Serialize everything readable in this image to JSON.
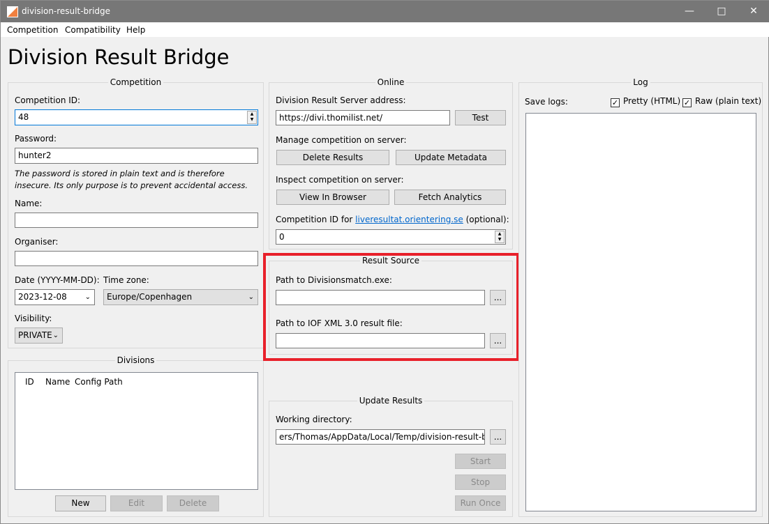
{
  "window": {
    "title": "division-result-bridge",
    "controls": [
      "minimize",
      "maximize",
      "close"
    ]
  },
  "menu": [
    "Competition",
    "Compatibility",
    "Help"
  ],
  "heading": "Division Result Bridge",
  "competition": {
    "title": "Competition",
    "id_label": "Competition ID:",
    "id_value": "48",
    "password_label": "Password:",
    "password_value": "hunter2",
    "password_note": "The password is stored in plain text and is therefore insecure. Its only purpose is to prevent accidental access.",
    "name_label": "Name:",
    "name_value": "",
    "organiser_label": "Organiser:",
    "organiser_value": "",
    "date_label": "Date (YYYY-MM-DD):",
    "date_value": "2023-12-08",
    "timezone_label": "Time zone:",
    "timezone_value": "Europe/Copenhagen",
    "visibility_label": "Visibility:",
    "visibility_value": "PRIVATE"
  },
  "divisions": {
    "title": "Divisions",
    "columns": [
      "ID",
      "Name",
      "Config Path"
    ],
    "new": "New",
    "edit": "Edit",
    "delete": "Delete"
  },
  "online": {
    "title": "Online",
    "server_label": "Division Result Server address:",
    "server_value": "https://divi.thomilist.net/",
    "test": "Test",
    "manage_label": "Manage competition on server:",
    "delete_results": "Delete Results",
    "update_metadata": "Update Metadata",
    "inspect_label": "Inspect competition on server:",
    "view_browser": "View In Browser",
    "fetch_analytics": "Fetch Analytics",
    "live_label_pre": "Competition ID for ",
    "live_link": "liveresultat.orientering.se",
    "live_label_post": " (optional):",
    "live_value": "0"
  },
  "result_source": {
    "title": "Result Source",
    "exe_label": "Path to Divisionsmatch.exe:",
    "exe_value": "",
    "xml_label": "Path to IOF XML 3.0 result file:",
    "xml_value": "",
    "browse": "...",
    "highlight_color": "#e8202a"
  },
  "update": {
    "title": "Update Results",
    "workdir_label": "Working directory:",
    "workdir_value": "ers/Thomas/AppData/Local/Temp/division-result-bridge",
    "browse": "...",
    "start": "Start",
    "stop": "Stop",
    "run_once": "Run Once"
  },
  "log": {
    "title": "Log",
    "save_label": "Save logs:",
    "pretty": "Pretty (HTML)",
    "pretty_checked": true,
    "raw": "Raw (plain text)",
    "raw_checked": true
  }
}
